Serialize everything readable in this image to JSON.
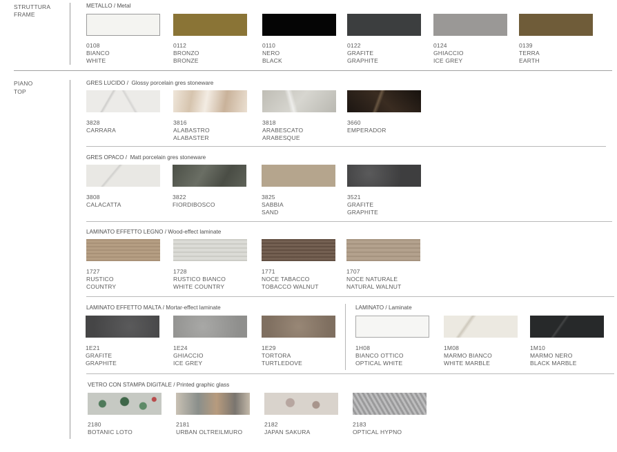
{
  "sections": {
    "frame": {
      "label_it": "STRUTTURA",
      "label_en": "FRAME"
    },
    "top": {
      "label_it": "PIANO",
      "label_en": "TOP"
    }
  },
  "groups": {
    "metal": {
      "it": "METALLO",
      "en": "Metal"
    },
    "glossy": {
      "it": "GRES LUCIDO",
      "en": "Glossy porcelain gres stoneware"
    },
    "matt": {
      "it": "GRES OPACO",
      "en": "Matt porcelain gres stoneware"
    },
    "wood": {
      "it": "LAMINATO EFFETTO LEGNO",
      "en": "Wood-effect laminate"
    },
    "mortar": {
      "it": "LAMINATO EFFETTO MALTA",
      "en": "Mortar-effect laminate"
    },
    "laminate": {
      "it": "LAMINATO",
      "en": "Laminate"
    },
    "glass": {
      "it": "VETRO CON STAMPA DIGITALE",
      "en": "Printed graphic glass"
    }
  },
  "swatches": {
    "metal": [
      {
        "code": "0108",
        "it": "BIANCO",
        "en": "WHITE",
        "color": "#f4f4f1",
        "border": "#9a9a9a"
      },
      {
        "code": "0112",
        "it": "BRONZO",
        "en": "BRONZE",
        "color": "#8a7436"
      },
      {
        "code": "0110",
        "it": "NERO",
        "en": "BLACK",
        "color": "#050505"
      },
      {
        "code": "0122",
        "it": "GRAFITE",
        "en": "GRAPHITE",
        "color": "#3c3e3f"
      },
      {
        "code": "0124",
        "it": "GHIACCIO",
        "en": "ICE GREY",
        "color": "#9a9896"
      },
      {
        "code": "0139",
        "it": "TERRA",
        "en": "EARTH",
        "color": "#6f5c39"
      }
    ],
    "glossy": [
      {
        "code": "3828",
        "it": "CARRARA",
        "en": "",
        "color": "#ecebe8"
      },
      {
        "code": "3816",
        "it": "ALABASTRO",
        "en": "ALABASTER",
        "color": "#e2d6c8"
      },
      {
        "code": "3818",
        "it": "ARABESCATO",
        "en": "ARABESQUE",
        "color": "#c9c8c1"
      },
      {
        "code": "3660",
        "it": "EMPERADOR",
        "en": "",
        "color": "#2b2119"
      }
    ],
    "matt": [
      {
        "code": "3808",
        "it": "CALACATTA",
        "en": "",
        "color": "#e9e8e4"
      },
      {
        "code": "3822",
        "it": "FIORDIBOSCO",
        "en": "",
        "color": "#55594f"
      },
      {
        "code": "3825",
        "it": "SABBIA",
        "en": "SAND",
        "color": "#b5a58d"
      },
      {
        "code": "3521",
        "it": "GRAFITE",
        "en": "GRAPHITE",
        "color": "#4a4a4b"
      }
    ],
    "wood": [
      {
        "code": "1727",
        "it": "RUSTICO",
        "en": "COUNTRY",
        "color": "#b29a7e"
      },
      {
        "code": "1728",
        "it": "RUSTICO BIANCO",
        "en": "WHITE COUNTRY",
        "color": "#d7d7d1"
      },
      {
        "code": "1771",
        "it": "NOCE TABACCO",
        "en": "TOBACCO WALNUT",
        "color": "#6d5849"
      },
      {
        "code": "1707",
        "it": "NOCE NATURALE",
        "en": "NATURAL WALNUT",
        "color": "#ae9b86"
      }
    ],
    "mortar": [
      {
        "code": "1E21",
        "it": "GRAFITE",
        "en": "GRAPHITE",
        "color": "#4f4f50"
      },
      {
        "code": "1E24",
        "it": "GHIACCIO",
        "en": "ICE GREY",
        "color": "#9d9d9b"
      },
      {
        "code": "1E29",
        "it": "TORTORA",
        "en": "TURTLEDOVE",
        "color": "#8c7b6b"
      }
    ],
    "laminate": [
      {
        "code": "1H08",
        "it": "BIANCO OTTICO",
        "en": "OPTICAL WHITE",
        "color": "#f6f6f4",
        "border": "#a8a8a8"
      },
      {
        "code": "1M08",
        "it": "MARMO BIANCO",
        "en": "WHITE MARBLE",
        "color": "#ece9e1"
      },
      {
        "code": "1M10",
        "it": "MARMO NERO",
        "en": "BLACK MARBLE",
        "color": "#27292a"
      }
    ],
    "glass": [
      {
        "code": "2180",
        "it": "BOTANIC LOTO",
        "en": "",
        "color": "#c6c9c3"
      },
      {
        "code": "2181",
        "it": "URBAN OLTREILMURO",
        "en": "",
        "color": "#a59b8d"
      },
      {
        "code": "2182",
        "it": "JAPAN SAKURA",
        "en": "",
        "color": "#d9d3cc"
      },
      {
        "code": "2183",
        "it": "OPTICAL HYPNO",
        "en": "",
        "color": "#a7a7a8"
      }
    ]
  }
}
